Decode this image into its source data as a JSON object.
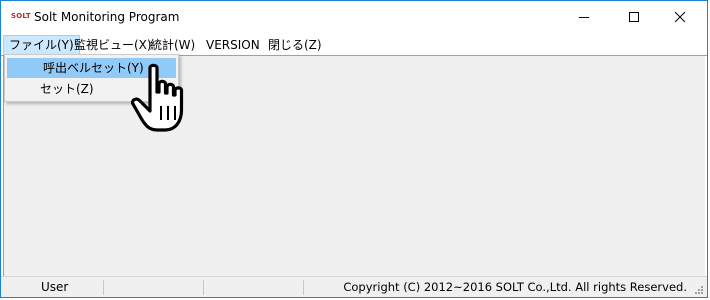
{
  "window": {
    "logo_text": "SOLT",
    "title": "Solt Monitoring Program",
    "controls": {
      "minimize": "minimize-icon",
      "maximize": "maximize-icon",
      "close": "close-icon"
    }
  },
  "menubar": {
    "items": [
      {
        "label": "ファイル(Y)"
      },
      {
        "label": "監視ビュー(X)"
      },
      {
        "label": "統計(W)"
      },
      {
        "label": "VERSION"
      },
      {
        "label": "閉じる(Z)"
      }
    ]
  },
  "file_menu": {
    "items": [
      {
        "label": "呼出ベルセット(Y)"
      },
      {
        "label": "セット(Z)"
      }
    ]
  },
  "cursor": {
    "icon": "hand-pointer-icon"
  },
  "statusbar": {
    "user": "User",
    "copyright": "Copyright (C) 2012~2016 SOLT Co.,Ltd. All rights Reserved."
  },
  "colors": {
    "window_border": "#1883d7",
    "menu_active_bg": "#cce8ff",
    "dropdown_hover_bg": "#91c9f7",
    "client_bg": "#f0f0f0",
    "logo_red": "#d32020"
  }
}
